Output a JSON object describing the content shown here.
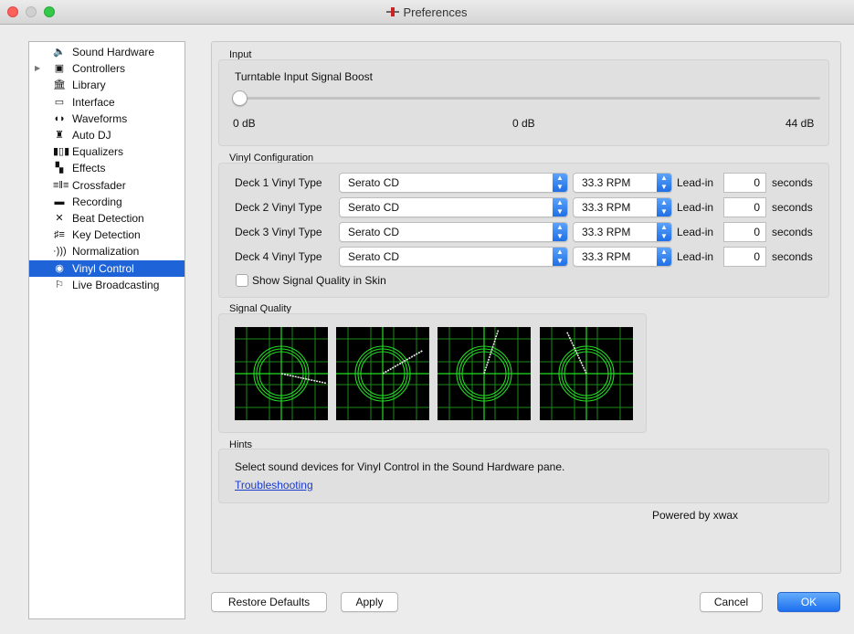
{
  "window": {
    "title": "Preferences"
  },
  "sidebar": {
    "items": [
      {
        "label": "Sound Hardware",
        "icon": "speaker-icon",
        "glyph": "🔈",
        "disclosure": false,
        "selected": false
      },
      {
        "label": "Controllers",
        "icon": "controller-icon",
        "glyph": "▣",
        "disclosure": true,
        "selected": false
      },
      {
        "label": "Library",
        "icon": "library-icon",
        "glyph": "🏛",
        "disclosure": false,
        "selected": false
      },
      {
        "label": "Interface",
        "icon": "monitor-icon",
        "glyph": "▭",
        "disclosure": false,
        "selected": false
      },
      {
        "label": "Waveforms",
        "icon": "waveform-icon",
        "glyph": "◖◗",
        "disclosure": false,
        "selected": false
      },
      {
        "label": "Auto DJ",
        "icon": "robot-icon",
        "glyph": "♜",
        "disclosure": false,
        "selected": false
      },
      {
        "label": "Equalizers",
        "icon": "equalizer-icon",
        "glyph": "▮▯▮",
        "disclosure": false,
        "selected": false
      },
      {
        "label": "Effects",
        "icon": "effects-icon",
        "glyph": "▚",
        "disclosure": false,
        "selected": false
      },
      {
        "label": "Crossfader",
        "icon": "crossfader-icon",
        "glyph": "≡‖≡",
        "disclosure": false,
        "selected": false
      },
      {
        "label": "Recording",
        "icon": "recording-icon",
        "glyph": "▬",
        "disclosure": false,
        "selected": false
      },
      {
        "label": "Beat Detection",
        "icon": "beat-detection-icon",
        "glyph": "✕",
        "disclosure": false,
        "selected": false
      },
      {
        "label": "Key Detection",
        "icon": "key-detection-icon",
        "glyph": "♯≡",
        "disclosure": false,
        "selected": false
      },
      {
        "label": "Normalization",
        "icon": "normalization-icon",
        "glyph": "·)))",
        "disclosure": false,
        "selected": false
      },
      {
        "label": "Vinyl Control",
        "icon": "vinyl-icon",
        "glyph": "◉",
        "disclosure": false,
        "selected": true
      },
      {
        "label": "Live Broadcasting",
        "icon": "broadcast-icon",
        "glyph": "⚐",
        "disclosure": false,
        "selected": false
      }
    ]
  },
  "input": {
    "group_label": "Input",
    "boost_label": "Turntable Input Signal Boost",
    "boost_fraction": 0.0,
    "min_label": "0 dB",
    "current_label": "0 dB",
    "max_label": "44 dB"
  },
  "vinyl": {
    "group_label": "Vinyl Configuration",
    "decks": [
      {
        "label": "Deck 1 Vinyl Type",
        "type": "Serato CD",
        "speed": "33.3 RPM",
        "leadin_label": "Lead-in",
        "leadin": "0",
        "unit": "seconds"
      },
      {
        "label": "Deck 2 Vinyl Type",
        "type": "Serato CD",
        "speed": "33.3 RPM",
        "leadin_label": "Lead-in",
        "leadin": "0",
        "unit": "seconds"
      },
      {
        "label": "Deck 3 Vinyl Type",
        "type": "Serato CD",
        "speed": "33.3 RPM",
        "leadin_label": "Lead-in",
        "leadin": "0",
        "unit": "seconds"
      },
      {
        "label": "Deck 4 Vinyl Type",
        "type": "Serato CD",
        "speed": "33.3 RPM",
        "leadin_label": "Lead-in",
        "leadin": "0",
        "unit": "seconds"
      }
    ],
    "show_quality_label": "Show Signal Quality in Skin",
    "show_quality_checked": false
  },
  "signal_quality": {
    "group_label": "Signal Quality",
    "colors": {
      "background": "#000000",
      "grid": "#1a8a1a",
      "ring": "#22dd22",
      "needle": "#e8e8e8"
    },
    "scopes": [
      {
        "needle_angle_deg": 12
      },
      {
        "needle_angle_deg": -30
      },
      {
        "needle_angle_deg": -72
      },
      {
        "needle_angle_deg": -115
      }
    ]
  },
  "hints": {
    "group_label": "Hints",
    "text": "Select sound devices for Vinyl Control in the Sound Hardware pane.",
    "link": "Troubleshooting"
  },
  "powered_by": "Powered by xwax",
  "buttons": {
    "restore_defaults": "Restore Defaults",
    "apply": "Apply",
    "cancel": "Cancel",
    "ok": "OK"
  }
}
